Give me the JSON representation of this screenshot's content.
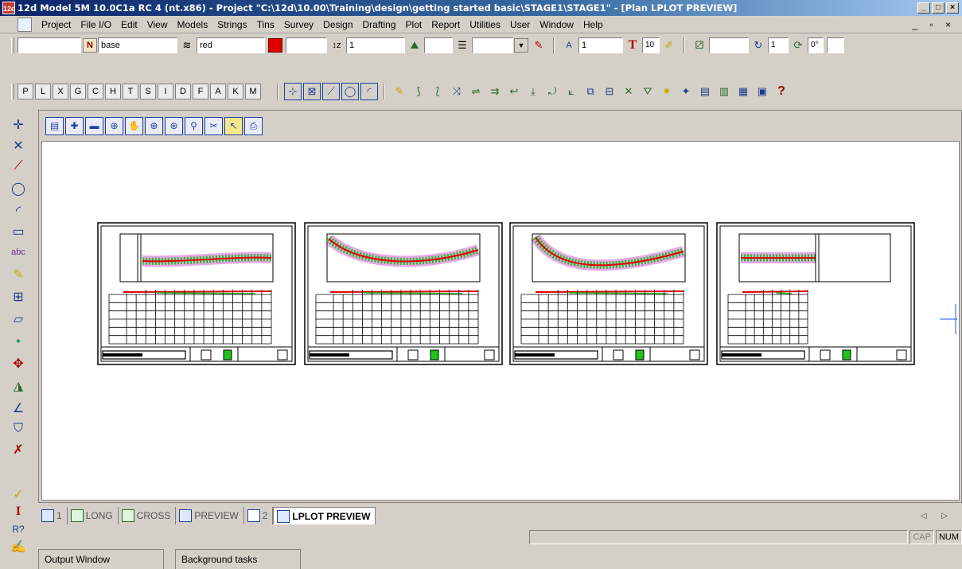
{
  "window": {
    "title": "12d Model 5M 10.0C1a RC 4 (nt.x86) - Project \"C:\\12d\\10.00\\Training\\design\\getting started basic\\STAGE1\\STAGE1\" - [Plan LPLOT PREVIEW]",
    "app_icon_text": "12d",
    "controls": [
      "_",
      "□",
      "×"
    ]
  },
  "menu": {
    "items": [
      "Project",
      "File I/O",
      "Edit",
      "View",
      "Models",
      "Strings",
      "Tins",
      "Survey",
      "Design",
      "Drafting",
      "Plot",
      "Report",
      "Utilities",
      "User",
      "Window",
      "Help"
    ],
    "mdi_controls": "_ ▫ ×"
  },
  "toolbar1": {
    "n_label": "N",
    "model_value": "base",
    "colour_value": "red",
    "colour_swatch": "#e00000",
    "z_value": "1",
    "text_size": "10",
    "t_label": "T",
    "tin_value": "1",
    "angle_value": "0°"
  },
  "toolbar2": {
    "letters": [
      "P",
      "L",
      "X",
      "G",
      "C",
      "H",
      "T",
      "S",
      "I",
      "D",
      "F",
      "A",
      "K",
      "M"
    ],
    "help": "?"
  },
  "tabs": [
    {
      "label": "1",
      "active": false
    },
    {
      "label": "LONG",
      "active": false
    },
    {
      "label": "CROSS",
      "active": false
    },
    {
      "label": "PREVIEW",
      "active": false
    },
    {
      "label": "2",
      "active": false
    },
    {
      "label": "LPLOT PREVIEW",
      "active": true
    }
  ],
  "tab_arrows": "◁ ▷",
  "status": {
    "caps": "CAP",
    "num": "NUM"
  },
  "bottom_tabs": [
    "Output Window",
    "Background tasks"
  ],
  "colors": {
    "accent_blue": "#0a246a",
    "road_green": "#21c21f",
    "road_red": "#e00000",
    "road_magenta": "#c000c0",
    "crosshair": "#2050ff"
  }
}
